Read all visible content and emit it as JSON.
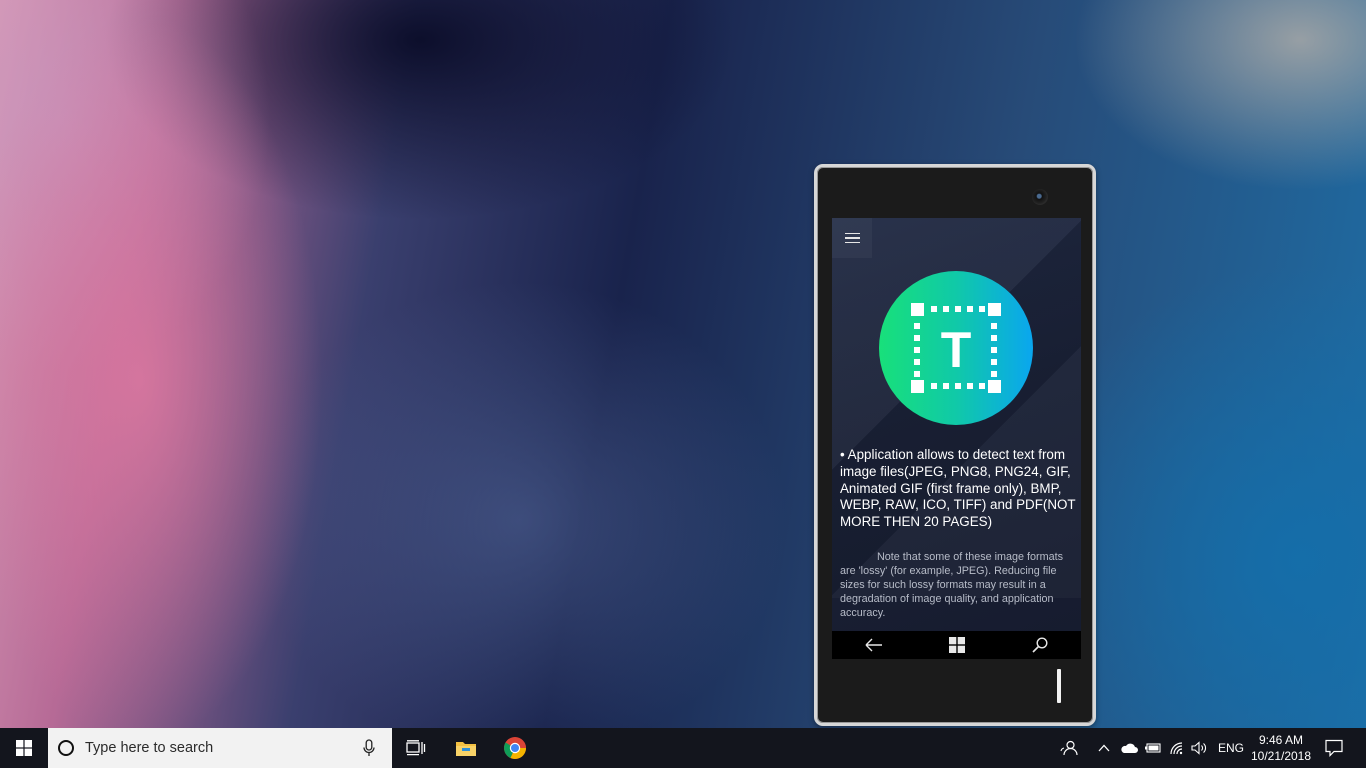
{
  "phone_app": {
    "menu_icon": "hamburger-menu-icon",
    "logo_icon": "text-recognition-logo",
    "logo_letter": "T",
    "logo_colors": [
      "#18e07a",
      "#0aa6ef"
    ],
    "description": "• Application allows to detect text from image files(JPEG, PNG8, PNG24, GIF, Animated GIF (first frame only), BMP, WEBP, RAW, ICO, TIFF) and PDF(NOT MORE THEN 20 PAGES)",
    "note": "Note that some of these image formats are 'lossy' (for example, JPEG). Reducing file sizes for such lossy formats may result in a degradation of image quality, and application accuracy.",
    "nav_buttons": [
      "back-arrow-icon",
      "windows-logo-icon",
      "search-icon"
    ]
  },
  "taskbar": {
    "search_placeholder": "Type here to search",
    "pinned_apps": [
      "task-view-icon",
      "file-explorer-icon",
      "chrome-icon"
    ],
    "tray_icons": [
      "people-icon",
      "chevron-up-icon",
      "onedrive-icon",
      "battery-icon",
      "wifi-icon",
      "volume-icon"
    ],
    "language": "ENG",
    "time": "9:46 AM",
    "date": "10/21/2018",
    "accent_color": "#13151d"
  }
}
